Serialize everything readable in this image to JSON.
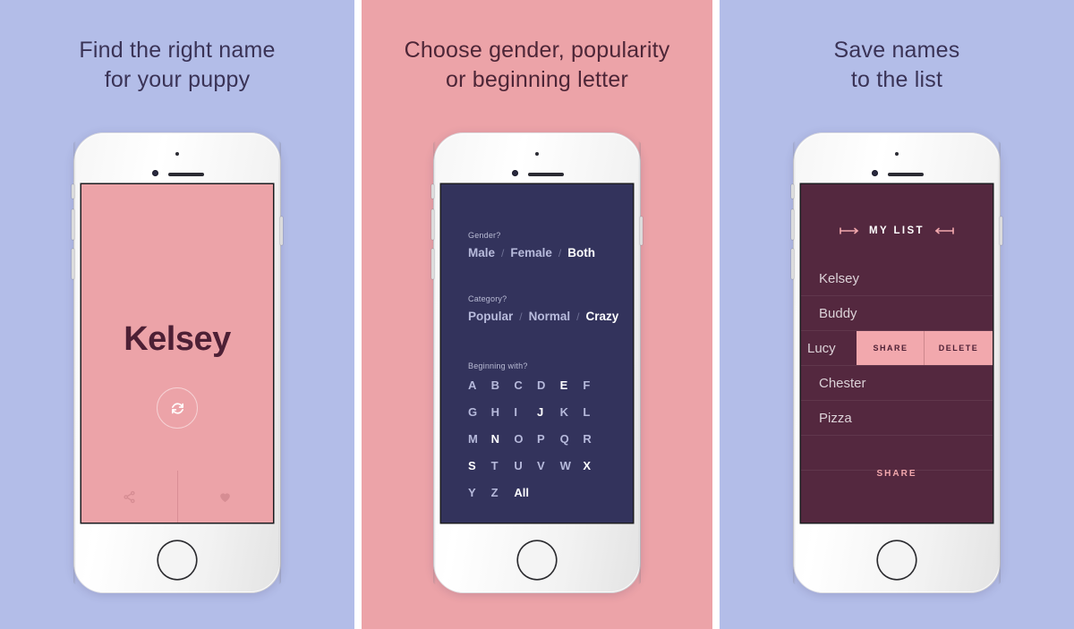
{
  "panels": [
    {
      "id": "find-name",
      "background": "#b3bde8",
      "headline_line1": "Find the right name",
      "headline_line2": "for your puppy",
      "screen": {
        "background": "#eca3a8",
        "name": "Kelsey",
        "refresh_icon": "refresh-icon",
        "share_icon": "share-icon",
        "favorite_icon": "heart-icon"
      }
    },
    {
      "id": "filters",
      "background": "#eca3a8",
      "headline_line1": "Choose gender, popularity",
      "headline_line2": "or beginning letter",
      "screen": {
        "background": "#33335c",
        "groups": [
          {
            "label": "Gender?",
            "options": [
              "Male",
              "Female",
              "Both"
            ],
            "selected": "Both"
          },
          {
            "label": "Category?",
            "options": [
              "Popular",
              "Normal",
              "Crazy"
            ],
            "selected": "Crazy"
          }
        ],
        "letters_label": "Beginning with?",
        "letters": [
          "A",
          "B",
          "C",
          "D",
          "E",
          "F",
          "G",
          "H",
          "I",
          "J",
          "K",
          "L",
          "M",
          "N",
          "O",
          "P",
          "Q",
          "R",
          "S",
          "T",
          "U",
          "V",
          "W",
          "X",
          "Y",
          "Z"
        ],
        "letters_highlighted": [
          "E",
          "J",
          "N",
          "S",
          "X"
        ],
        "all_label": "All"
      }
    },
    {
      "id": "saved-list",
      "background": "#b3bde8",
      "headline_line1": "Save names",
      "headline_line2": "to the list",
      "screen": {
        "background": "#54283f",
        "list_title": "MY LIST",
        "rows": [
          {
            "name": "Kelsey",
            "swiped": false
          },
          {
            "name": "Buddy",
            "swiped": false
          },
          {
            "name": "Lucy",
            "swiped": true,
            "actions": [
              "SHARE",
              "DELETE"
            ]
          },
          {
            "name": "Chester",
            "swiped": false
          },
          {
            "name": "Pizza",
            "swiped": false
          }
        ],
        "share_button": "SHARE"
      }
    }
  ],
  "colors": {
    "periwinkle": "#b3bde8",
    "salmon": "#eca3a8",
    "navy": "#33335c",
    "maroon": "#54283f",
    "pink_accent": "#f2a8ad",
    "heading_blue": "#3a3356",
    "heading_maroon": "#4d2637"
  }
}
